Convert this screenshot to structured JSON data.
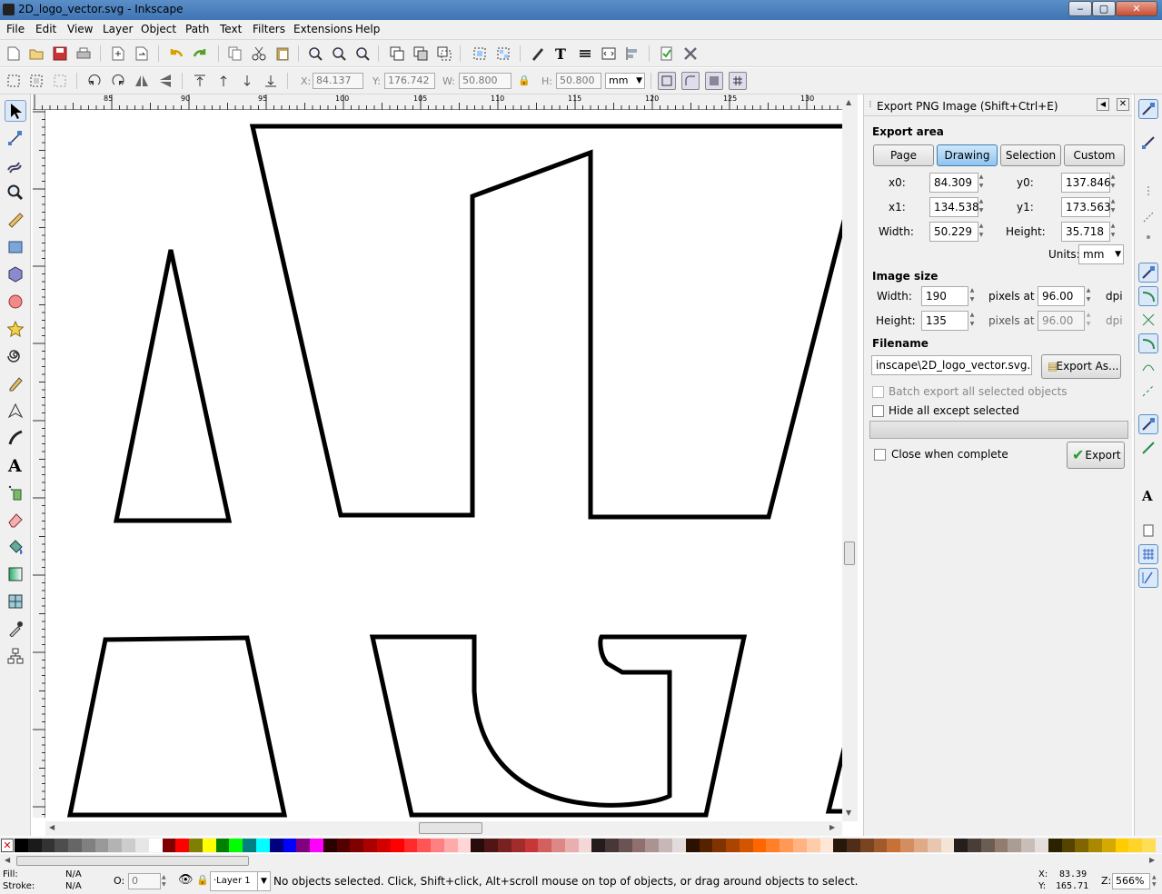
{
  "window": {
    "title": "2D_logo_vector.svg - Inkscape",
    "min": "‒",
    "max": "▢",
    "close": "✕"
  },
  "menu": [
    "File",
    "Edit",
    "View",
    "Layer",
    "Object",
    "Path",
    "Text",
    "Filters",
    "Extensions",
    "Help"
  ],
  "toolctrl": {
    "x_label": "X:",
    "x": "84.137",
    "y_label": "Y:",
    "y": "176.742",
    "w_label": "W:",
    "w": "50.800",
    "h_label": "H:",
    "h": "50.800",
    "unit": "mm"
  },
  "ruler_h": [
    "85",
    "90",
    "95",
    "100",
    "105",
    "110",
    "115",
    "120",
    "125",
    "130"
  ],
  "ruler_v": [
    "5",
    "7",
    "1",
    "1",
    "1",
    "1",
    "1",
    "1",
    "1",
    "1"
  ],
  "dialog": {
    "title": "Export PNG Image (Shift+Ctrl+E)",
    "export_area": "Export area",
    "area_buttons": [
      "Page",
      "Drawing",
      "Selection",
      "Custom"
    ],
    "active_area": "Drawing",
    "x0_label": "x0:",
    "x0": "84.309",
    "y0_label": "y0:",
    "y0": "137.846",
    "x1_label": "x1:",
    "x1": "134.538",
    "y1_label": "y1:",
    "y1": "173.563",
    "width_label": "Width:",
    "width": "50.229",
    "height_label": "Height:",
    "height": "35.718",
    "units_label": "Units:",
    "units": "mm",
    "image_size": "Image size",
    "img_width_label": "Width:",
    "img_width": "190",
    "img_height_label": "Height:",
    "img_height": "135",
    "pixels_at": "pixels at",
    "dpi_x": "96.00",
    "dpi_y": "96.00",
    "dpi": "dpi",
    "filename_label": "Filename",
    "filename": "inscape\\2D_logo_vector.svg.png",
    "export_as": "Export As...",
    "batch": "Batch export all selected objects",
    "hide": "Hide all except selected",
    "close_when": "Close when complete",
    "export": "Export"
  },
  "status": {
    "fill_label": "Fill:",
    "fill": "N/A",
    "stroke_label": "Stroke:",
    "stroke": "N/A",
    "opacity_label": "O:",
    "opacity": "0",
    "layer": "·Layer 1",
    "message": "No objects selected. Click, Shift+click, Alt+scroll mouse on top of objects, or drag around objects to select.",
    "x_label": "X:",
    "x": "83.39",
    "y_label": "Y:",
    "y": "165.71",
    "z_label": "Z:",
    "zoom": "566%"
  },
  "palette": [
    "#000000",
    "#1a1a1a",
    "#333333",
    "#4d4d4d",
    "#666666",
    "#808080",
    "#999999",
    "#b3b3b3",
    "#cccccc",
    "#e6e6e6",
    "#ffffff",
    "#800000",
    "#ff0000",
    "#808000",
    "#ffff00",
    "#008000",
    "#00ff00",
    "#008080",
    "#00ffff",
    "#000080",
    "#0000ff",
    "#800080",
    "#ff00ff",
    "#2b0000",
    "#550000",
    "#800000",
    "#aa0000",
    "#d40000",
    "#ff0000",
    "#ff2a2a",
    "#ff5555",
    "#ff8080",
    "#ffaaaa",
    "#ffd5d5",
    "#280b0b",
    "#501616",
    "#782121",
    "#a02c2c",
    "#c83737",
    "#d35f5f",
    "#de8787",
    "#e9afaf",
    "#f4d7d7",
    "#241c1c",
    "#483737",
    "#6c5353",
    "#916f6f",
    "#ac9393",
    "#c8b7b7",
    "#e3dbdb",
    "#2b1100",
    "#552200",
    "#803300",
    "#aa4400",
    "#d45500",
    "#ff6600",
    "#ff7f2a",
    "#ff9955",
    "#ffb380",
    "#ffccaa",
    "#ffe6d5",
    "#28170b",
    "#502d16",
    "#784421",
    "#a05a2c",
    "#c87137",
    "#d38d5f",
    "#deaa87",
    "#e9c6af",
    "#f4e3d7",
    "#241f1c",
    "#483e37",
    "#6c5d53",
    "#917c6f",
    "#ac9d93",
    "#c8beb7",
    "#e3dedb",
    "#2b2200",
    "#554400",
    "#806600",
    "#aa8800",
    "#d4aa00",
    "#ffcc00",
    "#ffd42a",
    "#ffdd55"
  ]
}
